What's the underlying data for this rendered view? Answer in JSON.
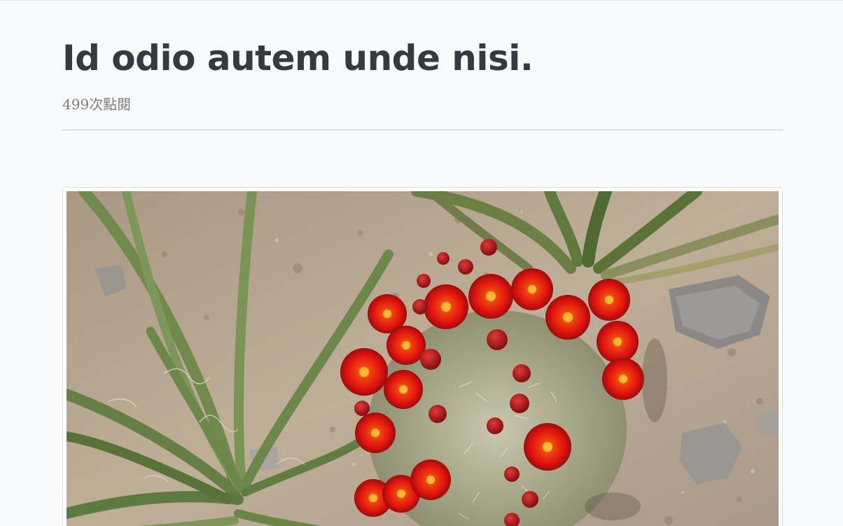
{
  "article": {
    "title": "Id odio autem unde nisi.",
    "view_count": "499",
    "view_suffix": "次點閱"
  },
  "image": {
    "subject": "red-flowering-claret-cup-cactus-with-yucca-on-rocky-ground"
  },
  "colors": {
    "background": "#f8f9fa",
    "title": "#343a40",
    "meta": "#7d7d7d",
    "divider": "#c8c9ca",
    "flower_red": "#e0140f",
    "leaf_green": "#6f8a4c",
    "soil": "#b5a591"
  }
}
